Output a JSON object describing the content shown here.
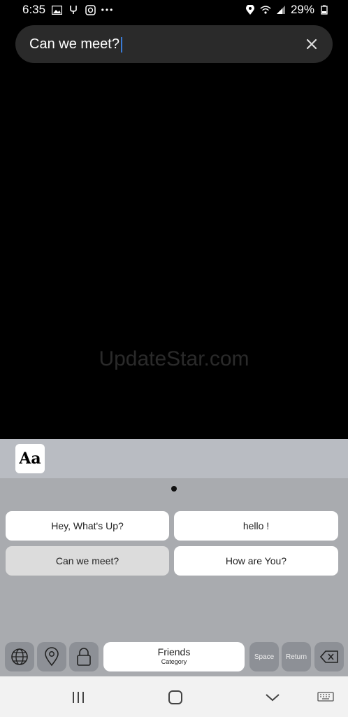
{
  "status_bar": {
    "time": "6:35",
    "battery": "29%"
  },
  "search": {
    "value": "Can we meet?"
  },
  "watermark": "UpdateStar.com",
  "keyboard": {
    "font_button_label": "Aa",
    "phrases": [
      "Hey, What's Up?",
      "hello !",
      "Can we meet?",
      "How are You?"
    ],
    "bottom": {
      "category_title": "Friends",
      "category_sub": "Category",
      "space_label": "Space",
      "return_label": "Return"
    }
  },
  "colors": {
    "caret": "#3a7bd5",
    "keyboard_bg": "#a9abaf",
    "toolbar_bg": "#b9bcc2"
  }
}
